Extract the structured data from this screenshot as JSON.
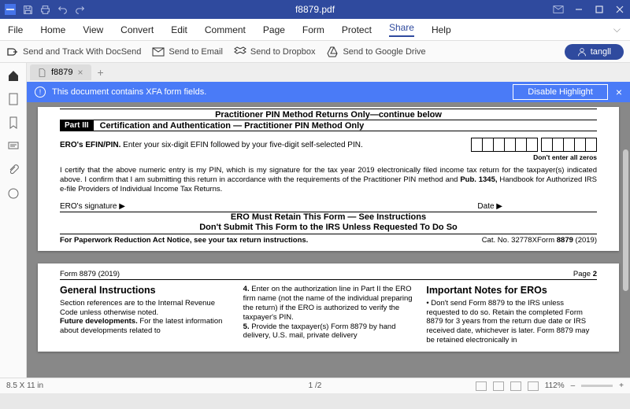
{
  "titlebar": {
    "filename": "f8879.pdf"
  },
  "menu": {
    "file": "File",
    "home": "Home",
    "view": "View",
    "convert": "Convert",
    "edit": "Edit",
    "comment": "Comment",
    "page": "Page",
    "form": "Form",
    "protect": "Protect",
    "share": "Share",
    "help": "Help"
  },
  "share": {
    "docsend": "Send and Track With DocSend",
    "email": "Send to Email",
    "dropbox": "Send to Dropbox",
    "gdrive": "Send to Google Drive",
    "user": "tangll"
  },
  "tab": {
    "name": "f8879"
  },
  "notice": {
    "text": "This document contains XFA form fields.",
    "disable": "Disable Highlight"
  },
  "doc": {
    "cont_header": "Practitioner PIN Method Returns Only—continue below",
    "part_badge": "Part III",
    "part_title": "Certification and Authentication — Practitioner PIN Method Only",
    "efin_label_b": "ERO's EFIN/PIN.",
    "efin_label": " Enter your six-digit EFIN followed by your five-digit self-selected PIN.",
    "noallzeros": "Don't enter all zeros",
    "cert": "I certify that the above numeric entry is my PIN, which is my signature for the tax year 2019 electronically filed income tax return for the taxpayer(s) indicated above. I confirm that I am submitting this return in accordance with the requirements of the Practitioner PIN method and ",
    "pub": "Pub. 1345,",
    "cert2": " Handbook for Authorized IRS e-file Providers of Individual Income Tax Returns.",
    "sig_l": "ERO's signature ▶",
    "sig_r": "Date ▶",
    "retain1": "ERO Must Retain This Form — See Instructions",
    "retain2": "Don't Submit This Form to the IRS Unless Requested To Do So",
    "pra": "For Paperwork Reduction Act Notice, see your tax return instructions.",
    "catno": "Cat. No. 32778X",
    "formno_pre": "Form ",
    "formno": "8879",
    "formno_yr": " (2019)",
    "p2_left": "Form 8879 (2019)",
    "p2_right_pre": "Page ",
    "p2_right": "2",
    "gi_h": "General Instructions",
    "gi_p1": "Section references are to the Internal Revenue Code unless otherwise noted.",
    "gi_fd": "Future developments.",
    "gi_fd_t": " For the latest information about developments related to",
    "mid_4b": "4.",
    "mid_4": " Enter on the authorization line in Part II the ERO firm name (not the name of the individual preparing the return) if the ERO is authorized to verify the taxpayer's PIN.",
    "mid_5b": "5.",
    "mid_5": " Provide the taxpayer(s) Form 8879 by hand delivery, U.S. mail, private delivery",
    "ero_h": "Important Notes for EROs",
    "ero_p": "• Don't send Form 8879 to the IRS unless requested to do so. Retain the completed Form 8879 for 3 years from the return due date or IRS received date, whichever is later. Form 8879 may be retained electronically in"
  },
  "status": {
    "dims": "8.5 X 11 in",
    "pages": "1 /2",
    "zoom": "112%"
  }
}
